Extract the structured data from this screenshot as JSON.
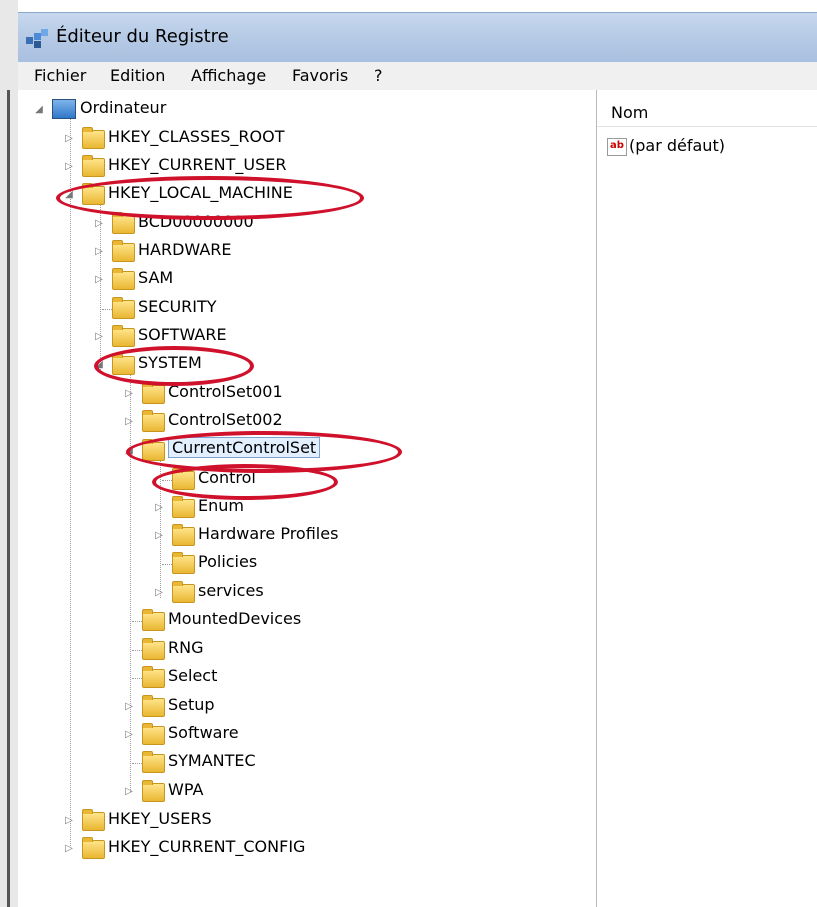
{
  "window": {
    "title": "Éditeur du Registre",
    "icon": "registry-editor-icon"
  },
  "menu": [
    "Fichier",
    "Edition",
    "Affichage",
    "Favoris",
    "?"
  ],
  "tree": {
    "root": "Ordinateur",
    "hives": [
      "HKEY_CLASSES_ROOT",
      "HKEY_CURRENT_USER",
      "HKEY_LOCAL_MACHINE",
      "HKEY_USERS",
      "HKEY_CURRENT_CONFIG"
    ],
    "hklm_children": [
      "BCD00000000",
      "HARDWARE",
      "SAM",
      "SECURITY",
      "SOFTWARE",
      "SYSTEM"
    ],
    "system_children": [
      "ControlSet001",
      "ControlSet002",
      "CurrentControlSet",
      "MountedDevices",
      "RNG",
      "Select",
      "Setup",
      "Software",
      "SYMANTEC",
      "WPA"
    ],
    "ccs_children": [
      "Control",
      "Enum",
      "Hardware Profiles",
      "Policies",
      "services"
    ]
  },
  "right_pane": {
    "column_header": "Nom",
    "values": [
      {
        "name": "(par défaut)",
        "type_icon": "ab"
      }
    ]
  },
  "colors": {
    "annotation": "#d0112b",
    "folder": "#e9b733",
    "titlebar": "#b7cbe6"
  }
}
